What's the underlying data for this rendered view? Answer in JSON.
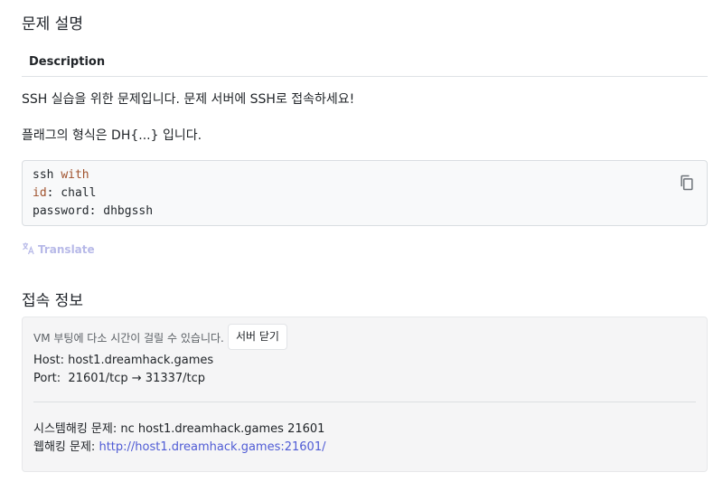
{
  "problem_section": {
    "title": "문제 설명",
    "tab_label": "Description",
    "paragraph_1": "SSH 실습을 위한 문제입니다. 문제 서버에 SSH로 접속하세요!",
    "paragraph_2": "플래그의 형식은 DH{...} 입니다.",
    "code": {
      "line1_plain": "ssh ",
      "line1_kw": "with",
      "line2_kw": "id",
      "line2_plain": ": chall",
      "line3": "password: dhbgssh"
    },
    "copy_icon": "copy-icon",
    "translate_label": "Translate",
    "translate_icon": "translate-icon"
  },
  "access_section": {
    "title": "접속 정보",
    "vm_note": "VM 부팅에 다소 시간이 걸릴 수 있습니다.",
    "close_server_button": "서버 닫기",
    "host_line": "Host: host1.dreamhack.games",
    "port_line": "Port:  21601/tcp → 31337/tcp",
    "system_hacking_line": "시스템해킹 문제: nc host1.dreamhack.games 21601",
    "web_hacking_label": "웹해킹 문제: ",
    "web_hacking_link": "http://host1.dreamhack.games:21601/"
  },
  "colors": {
    "link": "#4f5bd5",
    "keyword": "#a0522d",
    "translate": "#b7b9e8"
  }
}
